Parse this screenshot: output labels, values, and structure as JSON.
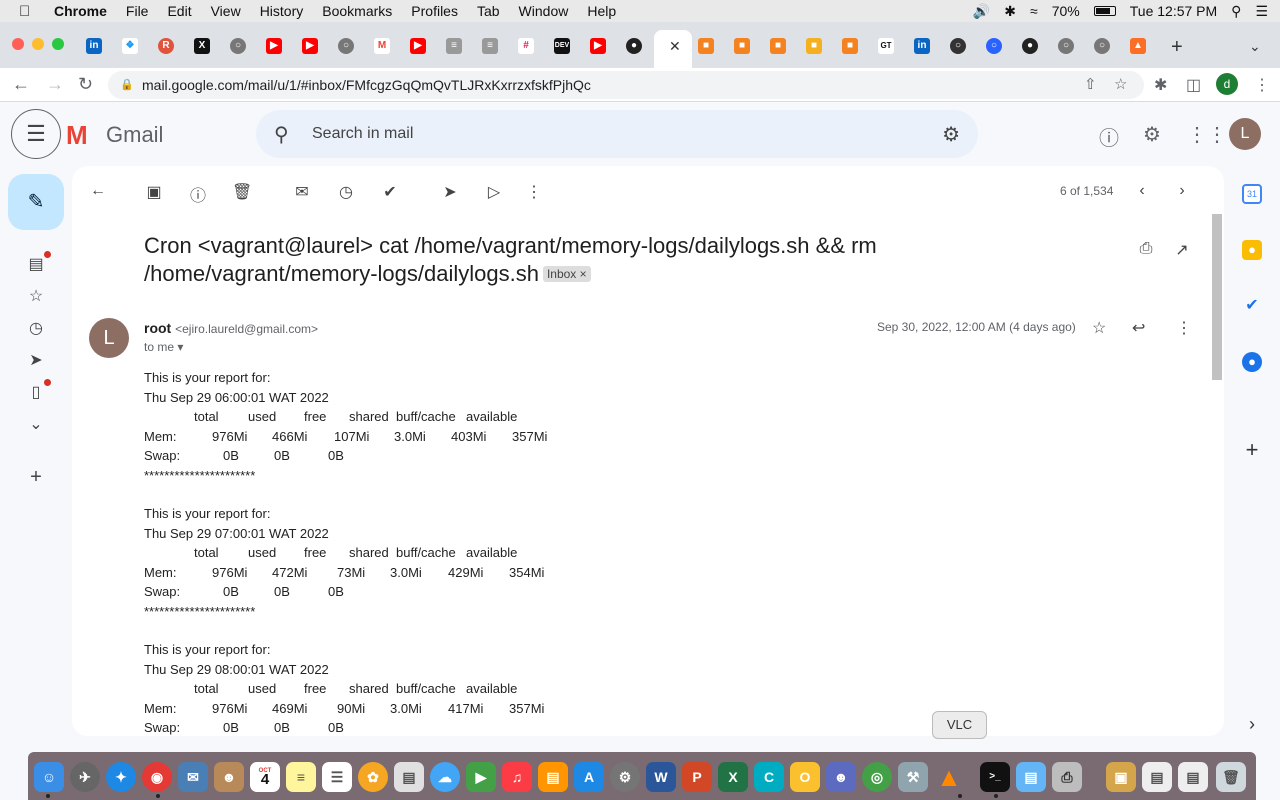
{
  "menubar": {
    "app": "Chrome",
    "items": [
      "File",
      "Edit",
      "View",
      "History",
      "Bookmarks",
      "Profiles",
      "Tab",
      "Window",
      "Help"
    ],
    "battery": "70%",
    "clock": "Tue 12:57 PM"
  },
  "browser": {
    "url": "mail.google.com/mail/u/1/#inbox/FMfcgzGqQmQvTLJRxKxrrzxfskfPjhQc",
    "profile_initial": "d"
  },
  "gmail": {
    "wordmark": "Gmail",
    "search_placeholder": "Search in mail",
    "account_initial": "L",
    "counter": "6 of 1,534",
    "subject_line1": "Cron <vagrant@laurel> cat /home/vagrant/memory-logs/dailylogs.sh && rm",
    "subject_line2": "/home/vagrant/memory-logs/dailylogs.sh",
    "inbox_label": "Inbox",
    "sender_initial": "L",
    "sender_name": "root",
    "sender_email": "<ejiro.laureld@gmail.com>",
    "to_me": "to me",
    "date": "Sep 30, 2022, 12:00 AM (4 days ago)"
  },
  "reports": [
    {
      "intro": "This is your report for:",
      "date": "Thu Sep 29 06:00:01 WAT 2022",
      "headers": [
        "total",
        "used",
        "free",
        "shared",
        "buff/cache",
        "available"
      ],
      "mem": [
        "Mem:",
        "976Mi",
        "466Mi",
        "107Mi",
        "3.0Mi",
        "403Mi",
        "357Mi"
      ],
      "swap": [
        "Swap:",
        "0B",
        "0B",
        "0B"
      ],
      "sep": "**********************"
    },
    {
      "intro": "This is your report for:",
      "date": "Thu Sep 29 07:00:01 WAT 2022",
      "headers": [
        "total",
        "used",
        "free",
        "shared",
        "buff/cache",
        "available"
      ],
      "mem": [
        "Mem:",
        "976Mi",
        "472Mi",
        "73Mi",
        "3.0Mi",
        "429Mi",
        "354Mi"
      ],
      "swap": [
        "Swap:",
        "0B",
        "0B",
        "0B"
      ],
      "sep": "**********************"
    },
    {
      "intro": "This is your report for:",
      "date": "Thu Sep 29 08:00:01 WAT 2022",
      "headers": [
        "total",
        "used",
        "free",
        "shared",
        "buff/cache",
        "available"
      ],
      "mem": [
        "Mem:",
        "976Mi",
        "469Mi",
        "90Mi",
        "3.0Mi",
        "417Mi",
        "357Mi"
      ],
      "swap": [
        "Swap:",
        "0B",
        "0B",
        "0B"
      ],
      "sep": ""
    }
  ],
  "dock": {
    "tooltip": "VLC",
    "calendar_day": "4",
    "calendar_month": "OCT"
  },
  "side_apps": {
    "calendar_day": "31"
  }
}
